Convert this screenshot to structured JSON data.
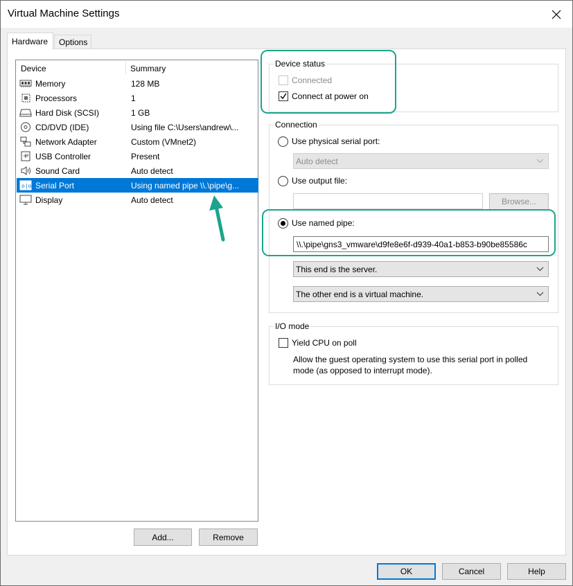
{
  "window": {
    "title": "Virtual Machine Settings"
  },
  "tabs": [
    {
      "label": "Hardware",
      "active": true
    },
    {
      "label": "Options",
      "active": false
    }
  ],
  "devices": {
    "headers": {
      "device": "Device",
      "summary": "Summary"
    },
    "rows": [
      {
        "name": "Memory",
        "summary": "128 MB",
        "icon": "memory-icon"
      },
      {
        "name": "Processors",
        "summary": "1",
        "icon": "processor-icon"
      },
      {
        "name": "Hard Disk (SCSI)",
        "summary": "1 GB",
        "icon": "hard-disk-icon"
      },
      {
        "name": "CD/DVD (IDE)",
        "summary": "Using file C:\\Users\\andrew\\...",
        "icon": "cd-dvd-icon"
      },
      {
        "name": "Network Adapter",
        "summary": "Custom (VMnet2)",
        "icon": "network-adapter-icon"
      },
      {
        "name": "USB Controller",
        "summary": "Present",
        "icon": "usb-icon"
      },
      {
        "name": "Sound Card",
        "summary": "Auto detect",
        "icon": "speaker-icon"
      },
      {
        "name": "Serial Port",
        "summary": "Using named pipe \\\\.\\pipe\\g...",
        "icon": "serial-port-icon",
        "selected": true
      },
      {
        "name": "Display",
        "summary": "Auto detect",
        "icon": "display-icon"
      }
    ],
    "add_label": "Add...",
    "remove_label": "Remove"
  },
  "device_status": {
    "title": "Device status",
    "connected": {
      "label": "Connected",
      "checked": false,
      "disabled": true
    },
    "connect_at_power_on": {
      "label": "Connect at power on",
      "checked": true
    }
  },
  "connection": {
    "title": "Connection",
    "physical": {
      "label": "Use physical serial port:",
      "selected": false,
      "value": "Auto detect"
    },
    "output_file": {
      "label": "Use output file:",
      "selected": false,
      "value": "",
      "browse_label": "Browse..."
    },
    "named_pipe": {
      "label": "Use named pipe:",
      "selected": true,
      "value": "\\\\.\\pipe\\gns3_vmware\\d9fe8e6f-d939-40a1-b853-b90be85586c",
      "end_option": "This end is the server.",
      "other_end_option": "The other end is a virtual machine."
    }
  },
  "io_mode": {
    "title": "I/O mode",
    "yield_cpu": {
      "label": "Yield CPU on poll",
      "checked": false
    },
    "description_line1": "Allow the guest operating system to use this serial port in polled",
    "description_line2": "mode (as opposed to interrupt mode)."
  },
  "footer": {
    "ok_label": "OK",
    "cancel_label": "Cancel",
    "help_label": "Help"
  },
  "colors": {
    "accent": "#0078d7",
    "highlight": "#1aa58c",
    "arrow": "#1aa58c"
  }
}
